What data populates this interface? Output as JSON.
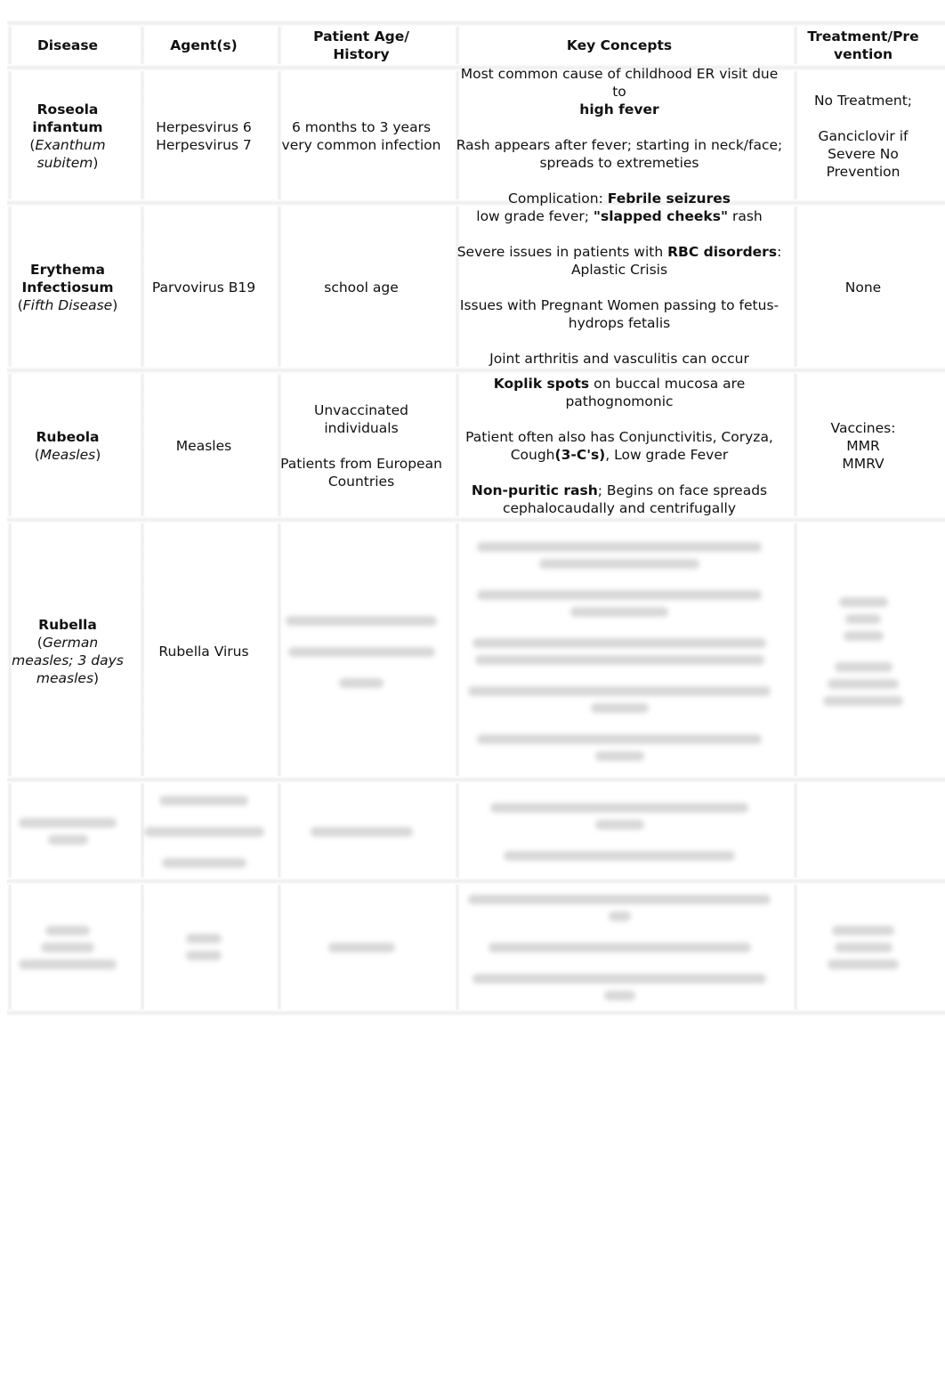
{
  "table": {
    "headers": {
      "disease": "Disease",
      "agents": "Agent(s)",
      "age_line1": "Patient Age/",
      "age_line2": "History",
      "key": "Key Concepts",
      "tx_line1": "Treatment/Pre",
      "tx_line2": "vention"
    },
    "rows": [
      {
        "disease_line1": "Roseola",
        "disease_line2": "infantum",
        "alt_open": "(",
        "alt_name": "Exanthum subitem",
        "alt_close": ")",
        "agent_line1": "Herpesvirus 6",
        "agent_line2": "Herpesvirus 7",
        "age_line1": "6 months to 3 years",
        "age_line2": "very common infection",
        "key": [
          {
            "pre": "Most common cause of childhood ER visit due to",
            "bold": "high fever",
            "post": ""
          },
          {
            "pre": "Rash appears after fever; starting in neck/face; spreads to extremeties",
            "bold": "",
            "post": ""
          },
          {
            "pre": "Complication: ",
            "bold": "Febrile seizures",
            "post": ""
          }
        ],
        "tx_line1": "No Treatment;",
        "tx_line2": "Ganciclovir if",
        "tx_line3": "Severe No",
        "tx_line4": "Prevention"
      },
      {
        "disease_line1": "Erythema",
        "disease_line2": "Infectiosum",
        "alt_open": "(",
        "alt_name": "Fifth Disease",
        "alt_close": ")",
        "agent_line1": "Parvovirus B19",
        "age_line1": "school age",
        "key": [
          {
            "pre": "low grade fever; ",
            "bold": "\"slapped cheeks\"",
            "post": " rash"
          },
          {
            "pre": "Severe issues in patients with ",
            "bold": "RBC disorders",
            "post": ": Aplastic Crisis"
          },
          {
            "pre": "Issues with Pregnant Women passing to fetus-hydrops fetalis",
            "bold": "",
            "post": ""
          },
          {
            "pre": "Joint arthritis and vasculitis can occur",
            "bold": "",
            "post": ""
          }
        ],
        "tx_line1": "None"
      },
      {
        "disease_line1": "Rubeola",
        "alt_open": "(",
        "alt_name": "Measles",
        "alt_close": ")",
        "agent_line1": "Measles",
        "age_line1": "Unvaccinated individuals",
        "age_line2": "Patients from European Countries",
        "key": [
          {
            "pre": "",
            "bold": "Koplik spots",
            "post": " on buccal mucosa are pathognomonic"
          },
          {
            "pre": "Patient often also has Conjunctivitis, Coryza, Cough",
            "bold": "(3-C's)",
            "post": ", Low grade Fever"
          },
          {
            "pre": "",
            "bold": "Non-puritic rash",
            "post": "; Begins on face spreads cephalocaudally and centrifugally"
          }
        ],
        "tx_line1": "Vaccines:",
        "tx_line2": "MMR",
        "tx_line3": "MMRV"
      },
      {
        "disease_line1": "Rubella",
        "alt_open": "(",
        "alt_name": "German measles; 3 days measles",
        "alt_close": ")",
        "agent_line1": "Rubella Virus",
        "redacted": true
      }
    ],
    "redacted_rows": 2
  }
}
